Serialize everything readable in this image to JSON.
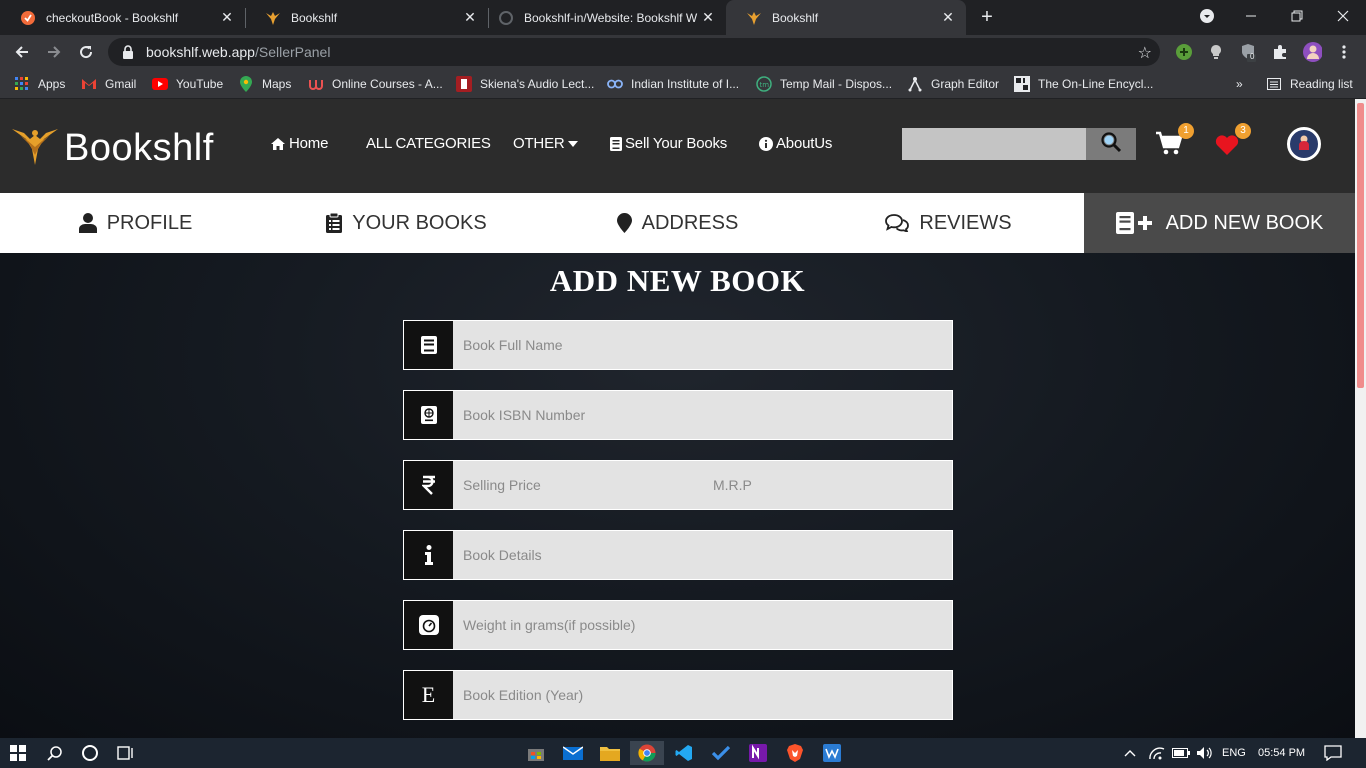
{
  "browser": {
    "tabs": [
      {
        "title": "checkoutBook - Bookshlf",
        "icon": "checkout-favicon"
      },
      {
        "title": "Bookshlf",
        "icon": "bookshlf-favicon"
      },
      {
        "title": "Bookshlf-in/Website: Bookshlf W",
        "icon": "github-favicon"
      },
      {
        "title": "Bookshlf",
        "icon": "bookshlf-favicon"
      }
    ],
    "url_host": "bookshlf.web.app",
    "url_path": "/SellerPanel",
    "bookmarks": [
      {
        "label": "Apps",
        "icon": "apps-grid-icon"
      },
      {
        "label": "Gmail",
        "icon": "gmail-icon"
      },
      {
        "label": "YouTube",
        "icon": "youtube-icon"
      },
      {
        "label": "Maps",
        "icon": "maps-icon"
      },
      {
        "label": "Online Courses - A...",
        "icon": "udemy-icon"
      },
      {
        "label": "Skiena's Audio Lect...",
        "icon": "stonybrook-icon"
      },
      {
        "label": "Indian Institute of I...",
        "icon": "link-icon"
      },
      {
        "label": "Temp Mail - Dispos...",
        "icon": "tempmail-icon"
      },
      {
        "label": "Graph Editor",
        "icon": "graph-editor-icon"
      },
      {
        "label": "The On-Line Encycl...",
        "icon": "oeis-icon"
      }
    ],
    "reading_list": "Reading list",
    "more_bookmarks": "»",
    "extension_badge": "0"
  },
  "site": {
    "brand": "Bookshlf",
    "nav": [
      {
        "label": "Home",
        "icon": "home-icon"
      },
      {
        "label": "ALL CATEGORIES",
        "icon": ""
      },
      {
        "label": "OTHER",
        "icon": "caret-down-icon"
      },
      {
        "label": "Sell Your Books",
        "icon": "book-icon"
      },
      {
        "label": "AboutUs",
        "icon": "info-icon"
      }
    ],
    "search_placeholder": "",
    "cart_count": "1",
    "wishlist_count": "3",
    "accent": "#f0a030"
  },
  "panel": {
    "tabs": [
      {
        "label": "PROFILE",
        "icon": "user-icon"
      },
      {
        "label": "YOUR BOOKS",
        "icon": "clipboard-icon"
      },
      {
        "label": "ADDRESS",
        "icon": "map-marker-icon"
      },
      {
        "label": "REVIEWS",
        "icon": "comments-icon"
      },
      {
        "label": "ADD NEW BOOK",
        "icon": "add-book-icon"
      }
    ],
    "active_tab": "ADD NEW BOOK"
  },
  "form": {
    "title": "ADD NEW BOOK",
    "fields": {
      "name": {
        "placeholder": "Book Full Name",
        "icon": "book-icon"
      },
      "isbn": {
        "placeholder": "Book ISBN Number",
        "icon": "passport-icon"
      },
      "price": {
        "placeholder": "Selling Price",
        "icon": "rupee-icon"
      },
      "mrp": {
        "placeholder": "M.R.P"
      },
      "details": {
        "placeholder": "Book Details",
        "icon": "info-icon"
      },
      "weight": {
        "placeholder": "Weight in grams(if possible)",
        "icon": "weight-scale-icon"
      },
      "edition": {
        "placeholder": "Book Edition (Year)",
        "icon": "edition-e-icon",
        "glyph": "E"
      }
    }
  },
  "taskbar": {
    "language": "ENG",
    "time": "05:54 PM"
  }
}
